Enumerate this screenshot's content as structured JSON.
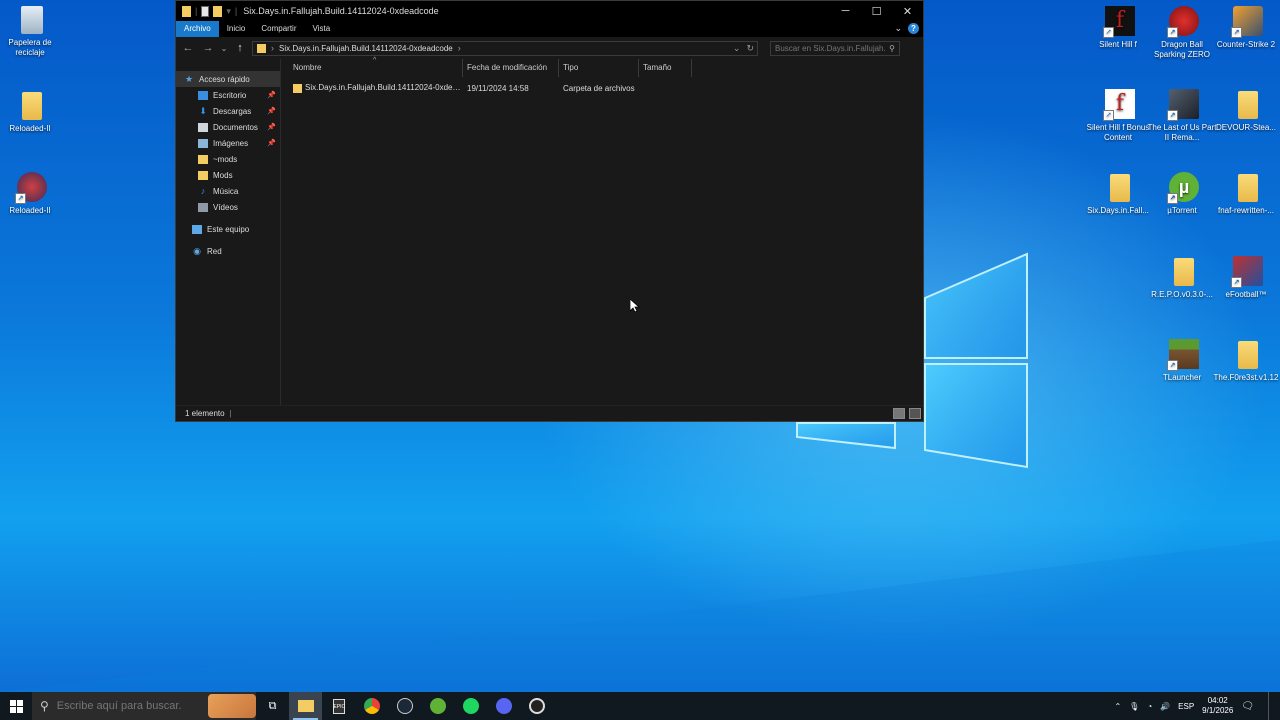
{
  "desktop": {
    "icons_left": [
      {
        "label": "Papelera de reciclaje",
        "icon": "recycle-bin-icon"
      },
      {
        "label": "Reloaded-II",
        "icon": "folder-icon"
      },
      {
        "label": "Reloaded-II",
        "icon": "reloaded-app-icon"
      }
    ],
    "icons_right": [
      {
        "label": "Silent Hill f",
        "icon": "silent-hill-icon"
      },
      {
        "label": "Dragon Ball Sparking ZERO",
        "icon": "dragon-ball-icon"
      },
      {
        "label": "Counter-Strike 2",
        "icon": "counter-strike-icon"
      },
      {
        "label": "Silent Hill f Bonus Content",
        "icon": "silent-hill-icon"
      },
      {
        "label": "The Last of Us Part II Rema...",
        "icon": "last-of-us-icon"
      },
      {
        "label": "DEVOUR-Stea...",
        "icon": "folder-icon"
      },
      {
        "label": "Six.Days.in.Fall...",
        "icon": "folder-icon"
      },
      {
        "label": "µTorrent",
        "icon": "utorrent-icon"
      },
      {
        "label": "fnaf-rewritten-...",
        "icon": "folder-icon"
      },
      {
        "label": "R.E.P.O.v0.3.0-...",
        "icon": "folder-icon"
      },
      {
        "label": "eFootball™",
        "icon": "efootball-icon"
      },
      {
        "label": "TLauncher",
        "icon": "minecraft-icon"
      },
      {
        "label": "The.F0re3st.v1.12",
        "icon": "folder-icon"
      }
    ]
  },
  "explorer": {
    "title": "Six.Days.in.Fallujah.Build.14112024-0xdeadcode",
    "ribbon_tabs": [
      "Archivo",
      "Inicio",
      "Compartir",
      "Vista"
    ],
    "address": "Six.Days.in.Fallujah.Build.14112024-0xdeadcode",
    "search_placeholder": "Buscar en Six.Days.in.Fallujah....",
    "nav": {
      "quick_access": "Acceso rápido",
      "pinned": [
        {
          "label": "Escritorio",
          "icon": "desktop-icon"
        },
        {
          "label": "Descargas",
          "icon": "download-icon"
        },
        {
          "label": "Documentos",
          "icon": "documents-icon"
        },
        {
          "label": "Imágenes",
          "icon": "pictures-icon"
        }
      ],
      "unpinned": [
        {
          "label": "~mods",
          "icon": "folder-icon"
        },
        {
          "label": "Mods",
          "icon": "folder-icon"
        },
        {
          "label": "Música",
          "icon": "music-icon"
        },
        {
          "label": "Vídeos",
          "icon": "videos-icon"
        }
      ],
      "this_pc": "Este equipo",
      "network": "Red"
    },
    "columns": [
      "Nombre",
      "Fecha de modificación",
      "Tipo",
      "Tamaño"
    ],
    "files": [
      {
        "name": "Six.Days.in.Fallujah.Build.14112024-0xdea...",
        "modified": "19/11/2024 14:58",
        "type": "Carpeta de archivos",
        "size": ""
      }
    ],
    "status": "1 elemento"
  },
  "taskbar": {
    "search_placeholder": "Escribe aquí para buscar.",
    "apps": [
      "task-view-icon",
      "file-explorer-icon",
      "epic-games-icon",
      "chrome-icon",
      "steam-icon",
      "utorrent-icon",
      "spotify-icon",
      "discord-icon",
      "steelseries-icon"
    ],
    "language": "ESP",
    "time": "04:02",
    "date": "9/1/2026"
  }
}
